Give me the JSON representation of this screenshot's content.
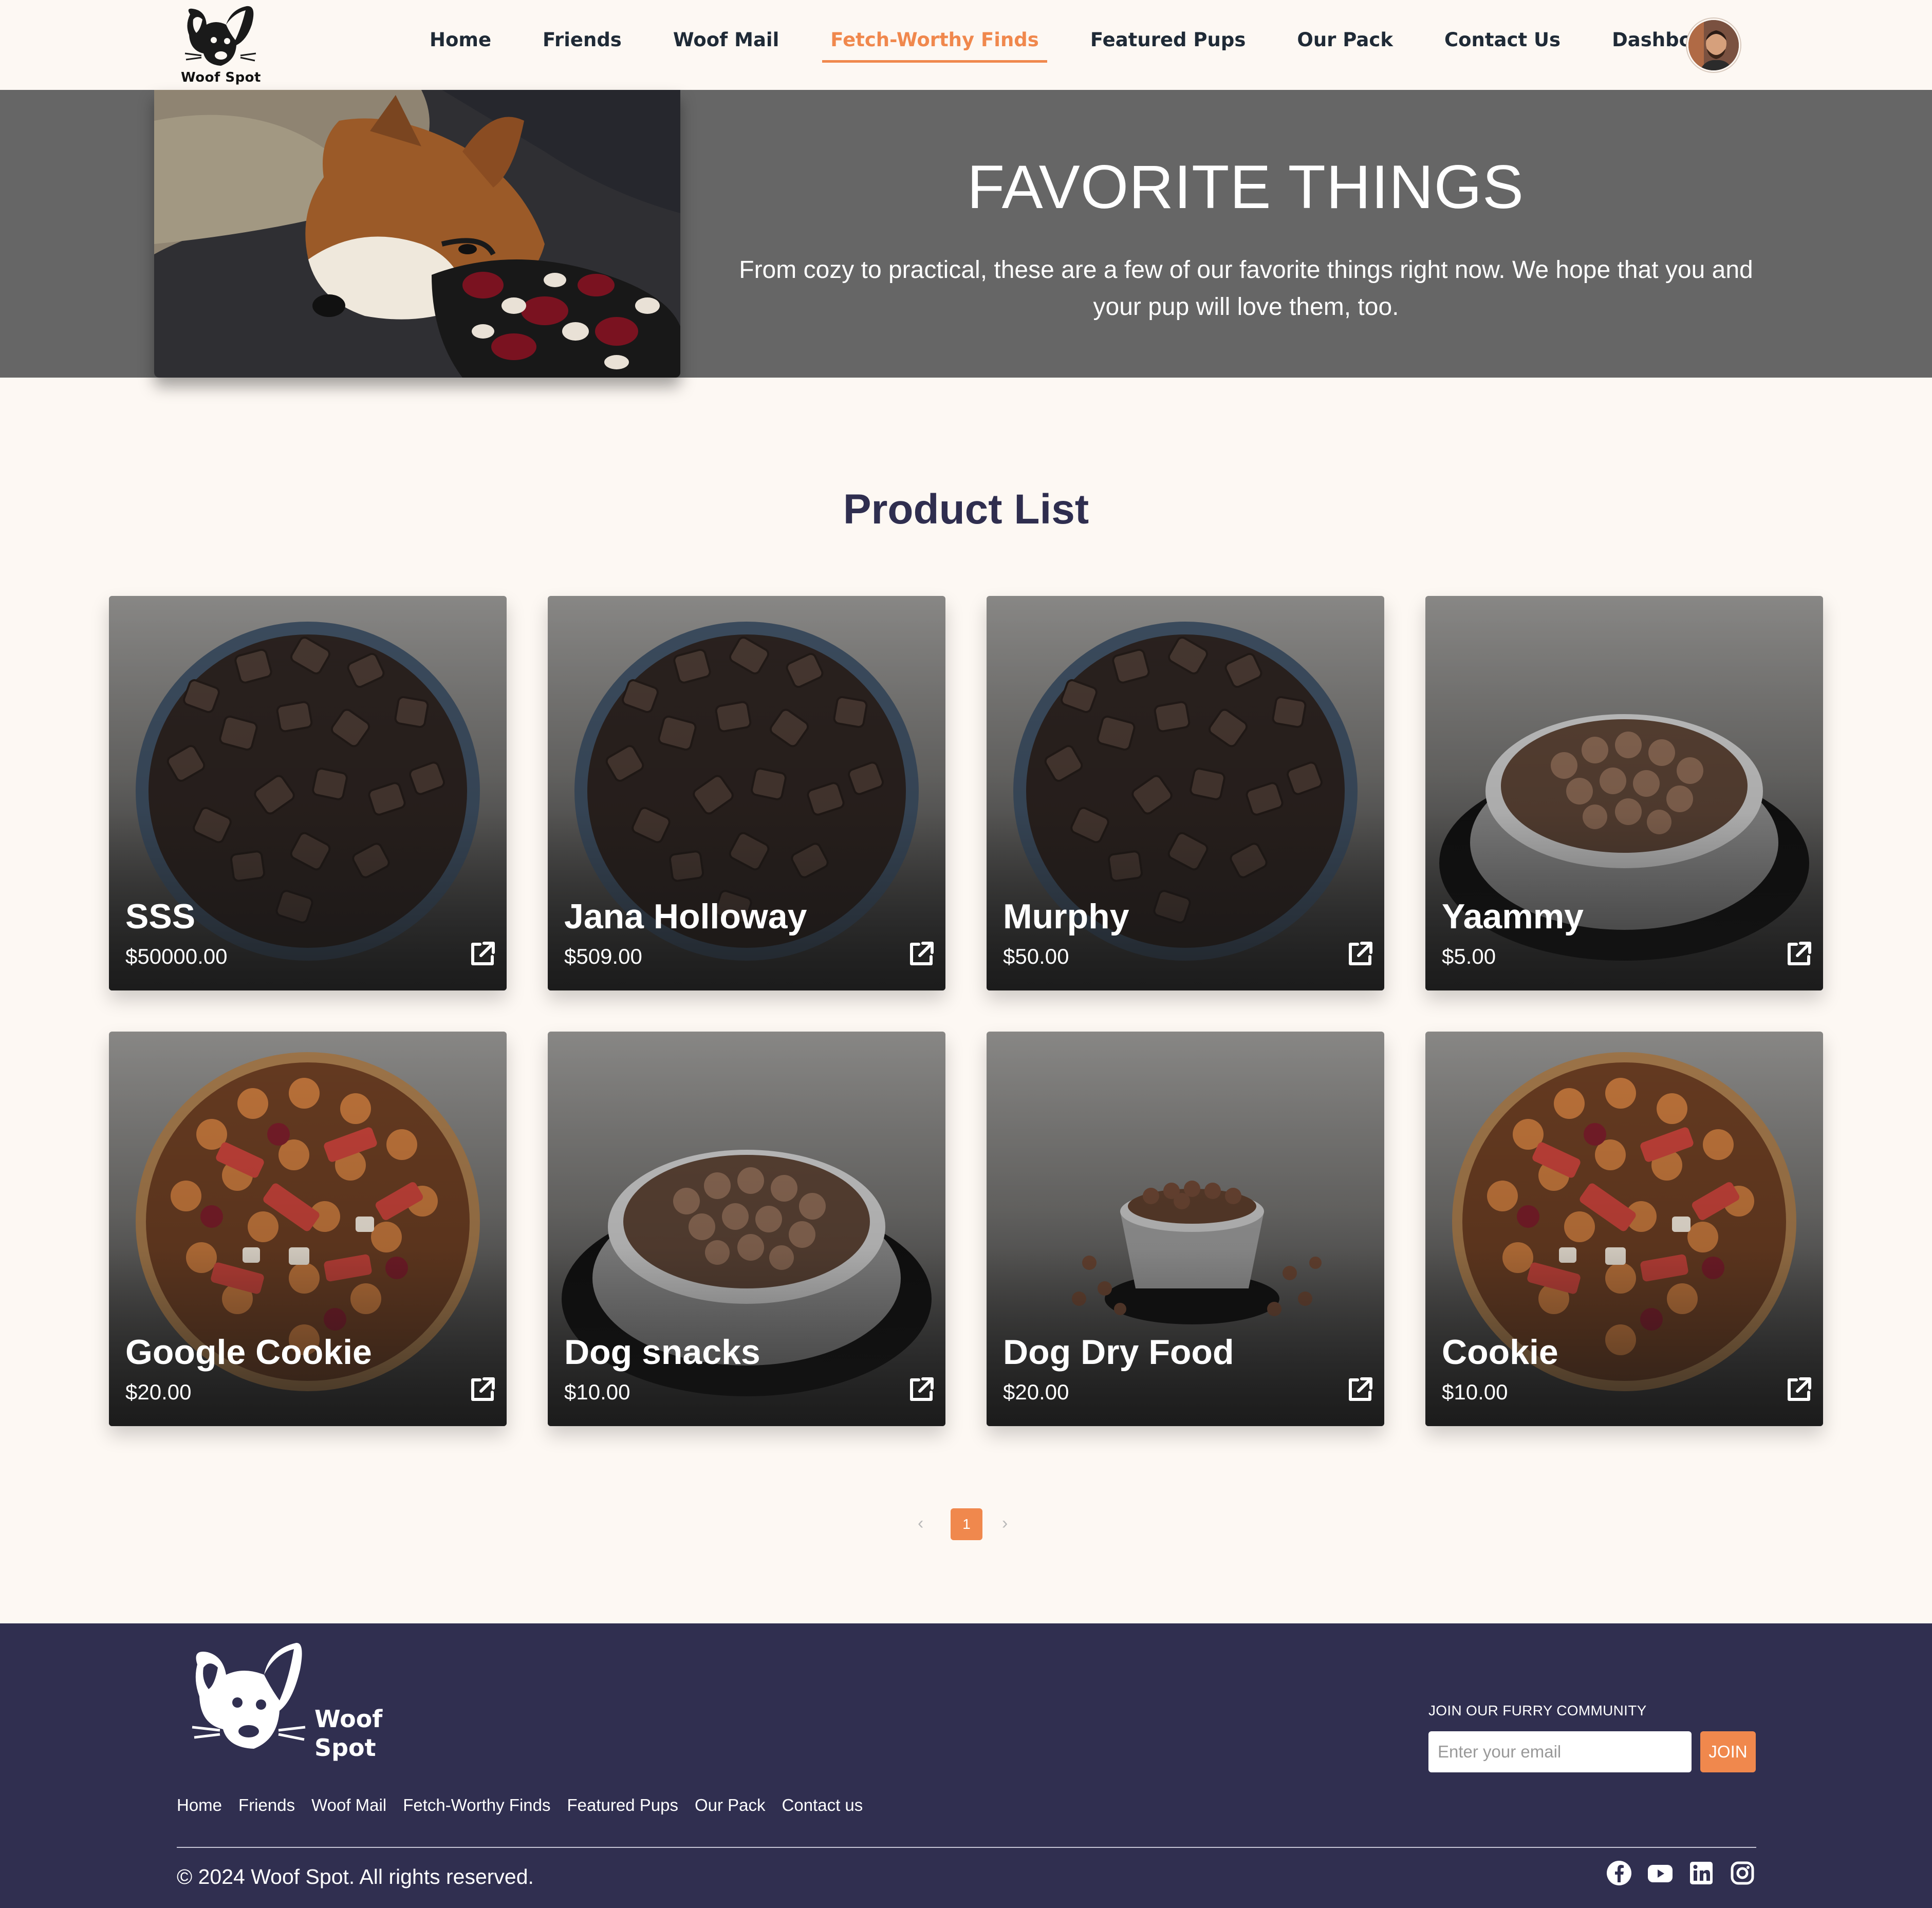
{
  "brand": {
    "name_line1": "Woof",
    "name_line2": "Spot",
    "logo_text": "Woof Spot"
  },
  "nav": {
    "items": [
      {
        "label": "Home"
      },
      {
        "label": "Friends"
      },
      {
        "label": "Woof Mail"
      },
      {
        "label": "Fetch-Worthy Finds",
        "active": true
      },
      {
        "label": "Featured Pups"
      },
      {
        "label": "Our Pack"
      },
      {
        "label": "Contact Us"
      },
      {
        "label": "Dashboard"
      }
    ],
    "avatar_icon": "user-avatar"
  },
  "hero": {
    "title": "FAVORITE THINGS",
    "description": "From cozy to practical, these are a few of our favorite things right now. We hope that you and your pup will love them, too."
  },
  "products": {
    "title": "Product List",
    "items": [
      {
        "name": "SSS",
        "price": "$50000.00",
        "image": "kibble-bowl-blue"
      },
      {
        "name": "Jana Holloway",
        "price": "$509.00",
        "image": "kibble-bowl-blue"
      },
      {
        "name": "Murphy",
        "price": "$50.00",
        "image": "kibble-bowl-blue"
      },
      {
        "name": "Yaammy",
        "price": "$5.00",
        "image": "steel-bowl"
      },
      {
        "name": "Google Cookie",
        "price": "$20.00",
        "image": "mixed-treats-bowl"
      },
      {
        "name": "Dog snacks",
        "price": "$10.00",
        "image": "steel-bowl"
      },
      {
        "name": "Dog Dry Food",
        "price": "$20.00",
        "image": "small-steel-bowl"
      },
      {
        "name": "Cookie",
        "price": "$10.00",
        "image": "mixed-treats-bowl"
      }
    ]
  },
  "pagination": {
    "prev": "‹",
    "current": "1",
    "next": "›"
  },
  "footer": {
    "links": [
      {
        "label": "Home"
      },
      {
        "label": "Friends"
      },
      {
        "label": "Woof Mail"
      },
      {
        "label": "Fetch-Worthy Finds"
      },
      {
        "label": "Featured Pups"
      },
      {
        "label": "Our Pack"
      },
      {
        "label": "Contact us"
      }
    ],
    "join_label": "JOIN OUR FURRY COMMUNITY",
    "email_placeholder": "Enter your email",
    "join_button": "JOIN",
    "copyright": "© 2024 Woof Spot. All rights reserved.",
    "socials": [
      "facebook-icon",
      "youtube-icon",
      "linkedin-icon",
      "instagram-icon"
    ]
  },
  "colors": {
    "accent": "#f0884d",
    "footer_bg": "#302f50",
    "hero_bg": "#666666",
    "page_bg": "#fdf8f3"
  }
}
